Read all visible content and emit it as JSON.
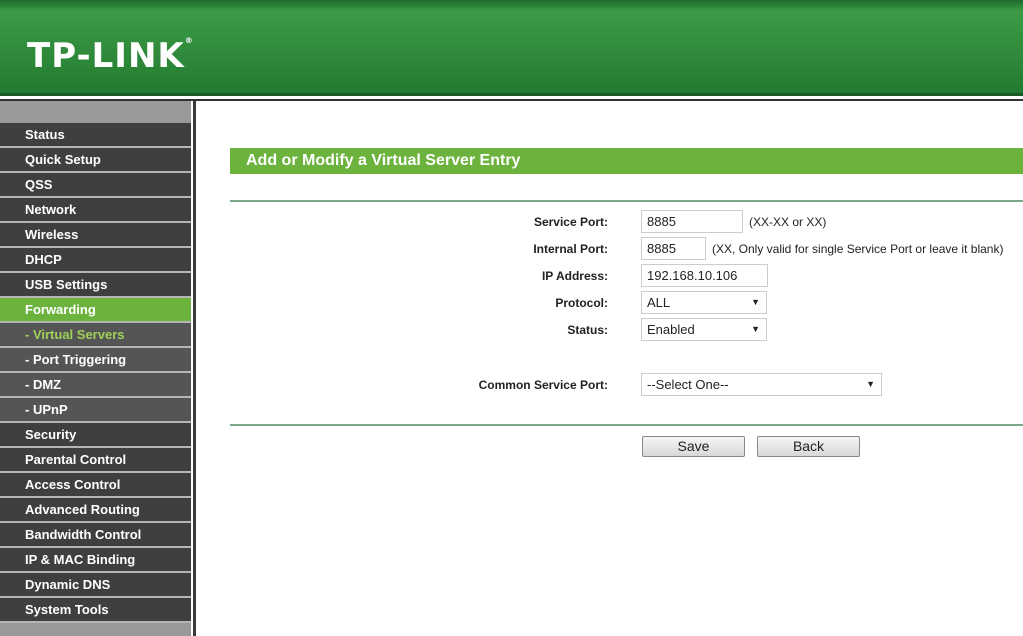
{
  "header": {
    "logo": "TP-LINK"
  },
  "sidebar": {
    "items": [
      {
        "label": "Status",
        "type": "main"
      },
      {
        "label": "Quick Setup",
        "type": "main"
      },
      {
        "label": "QSS",
        "type": "main"
      },
      {
        "label": "Network",
        "type": "main"
      },
      {
        "label": "Wireless",
        "type": "main"
      },
      {
        "label": "DHCP",
        "type": "main"
      },
      {
        "label": "USB Settings",
        "type": "main"
      },
      {
        "label": "Forwarding",
        "type": "active"
      },
      {
        "label": "- Virtual Servers",
        "type": "cur"
      },
      {
        "label": "- Port Triggering",
        "type": "sub"
      },
      {
        "label": "- DMZ",
        "type": "sub"
      },
      {
        "label": "- UPnP",
        "type": "sub"
      },
      {
        "label": "Security",
        "type": "main"
      },
      {
        "label": "Parental Control",
        "type": "main"
      },
      {
        "label": "Access Control",
        "type": "main"
      },
      {
        "label": "Advanced Routing",
        "type": "main"
      },
      {
        "label": "Bandwidth Control",
        "type": "main"
      },
      {
        "label": "IP & MAC Binding",
        "type": "main"
      },
      {
        "label": "Dynamic DNS",
        "type": "main"
      },
      {
        "label": "System Tools",
        "type": "main"
      }
    ]
  },
  "main": {
    "title": "Add or Modify a Virtual Server Entry",
    "service_port": {
      "label": "Service Port:",
      "value": "8885",
      "hint": "(XX-XX or XX)"
    },
    "internal_port": {
      "label": "Internal Port:",
      "value": "8885",
      "hint": "(XX, Only valid for single Service Port or leave it blank)"
    },
    "ip_address": {
      "label": "IP Address:",
      "value": "192.168.10.106"
    },
    "protocol": {
      "label": "Protocol:",
      "value": "ALL"
    },
    "status": {
      "label": "Status:",
      "value": "Enabled"
    },
    "common_port": {
      "label": "Common Service Port:",
      "value": "--Select One--"
    },
    "save": "Save",
    "back": "Back"
  },
  "colors": {
    "accent": "#6cb33e",
    "header": "#2e8a3a",
    "sidebar": "#3f3f3f"
  }
}
